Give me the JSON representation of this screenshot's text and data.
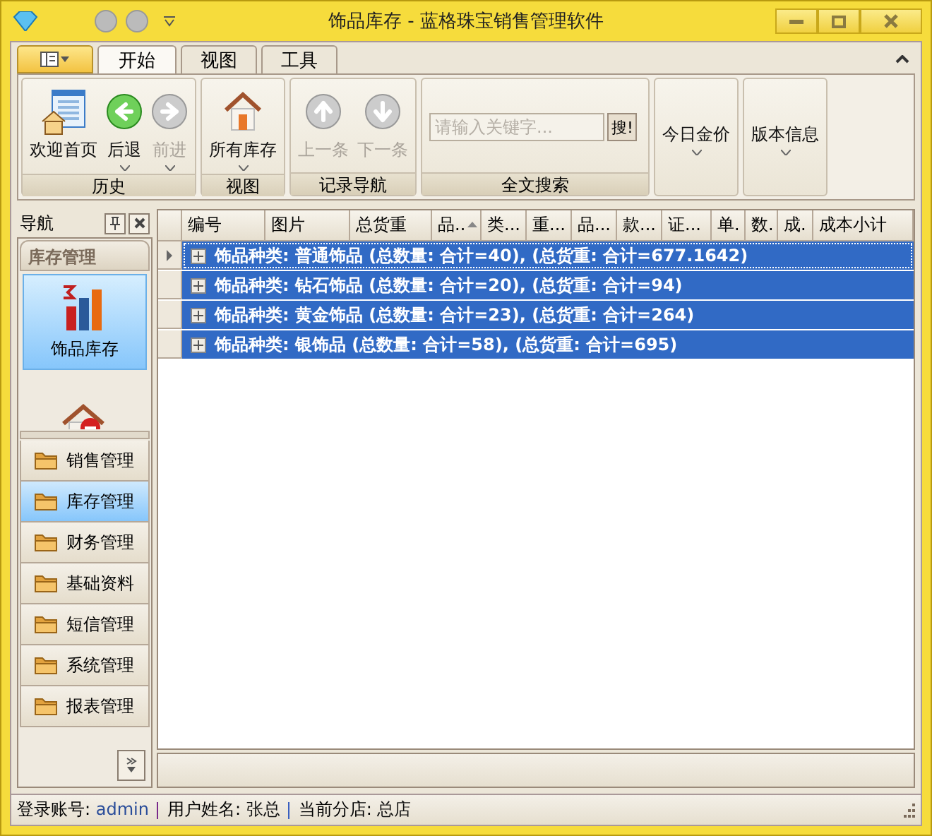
{
  "window": {
    "title": "饰品库存 - 蓝格珠宝销售管理软件"
  },
  "ribbon": {
    "tabs": [
      {
        "label": "开始",
        "selected": true
      },
      {
        "label": "视图",
        "selected": false
      },
      {
        "label": "工具",
        "selected": false
      }
    ],
    "groups": [
      {
        "label": "历史",
        "buttons": [
          {
            "label": "欢迎首页",
            "disabled": false,
            "dropdown": false
          },
          {
            "label": "后退",
            "disabled": false,
            "dropdown": true
          },
          {
            "label": "前进",
            "disabled": true,
            "dropdown": true
          }
        ]
      },
      {
        "label": "视图",
        "buttons": [
          {
            "label": "所有库存",
            "disabled": false,
            "dropdown": true
          }
        ]
      },
      {
        "label": "记录导航",
        "buttons": [
          {
            "label": "上一条",
            "disabled": true,
            "dropdown": false
          },
          {
            "label": "下一条",
            "disabled": true,
            "dropdown": false
          }
        ]
      },
      {
        "label": "全文搜索",
        "search": {
          "placeholder": "请输入关键字...",
          "button": "搜!"
        }
      },
      {
        "buttons": [
          {
            "label": "今日金价",
            "disabled": false,
            "dropdown": true
          }
        ]
      },
      {
        "buttons": [
          {
            "label": "版本信息",
            "disabled": false,
            "dropdown": true
          }
        ]
      }
    ]
  },
  "nav": {
    "title": "导航",
    "section": "库存管理",
    "large_items": [
      {
        "label": "饰品库存",
        "selected": true
      },
      {
        "selected": false
      }
    ],
    "groups": [
      {
        "label": "销售管理",
        "selected": false
      },
      {
        "label": "库存管理",
        "selected": true
      },
      {
        "label": "财务管理",
        "selected": false
      },
      {
        "label": "基础资料",
        "selected": false
      },
      {
        "label": "短信管理",
        "selected": false
      },
      {
        "label": "系统管理",
        "selected": false
      },
      {
        "label": "报表管理",
        "selected": false
      }
    ]
  },
  "table": {
    "columns": [
      {
        "label": "编号",
        "sorted": false
      },
      {
        "label": "图片",
        "sorted": false
      },
      {
        "label": "总货重",
        "sorted": false
      },
      {
        "label": "品..",
        "sorted": true
      },
      {
        "label": "类...",
        "sorted": false
      },
      {
        "label": "重...",
        "sorted": false
      },
      {
        "label": "品...",
        "sorted": false
      },
      {
        "label": "款...",
        "sorted": false
      },
      {
        "label": "证...",
        "sorted": false
      },
      {
        "label": "单.",
        "sorted": false
      },
      {
        "label": "数.",
        "sorted": false
      },
      {
        "label": "成.",
        "sorted": false
      },
      {
        "label": "成本小计",
        "sorted": false
      }
    ],
    "rows": [
      {
        "text": "饰品种类: 普通饰品 (总数量: 合计=40), (总货重: 合计=677.1642)",
        "current": true,
        "selected": true
      },
      {
        "text": "饰品种类: 钻石饰品 (总数量: 合计=20), (总货重: 合计=94)",
        "current": false,
        "selected": true
      },
      {
        "text": "饰品种类: 黄金饰品 (总数量: 合计=23), (总货重: 合计=264)",
        "current": false,
        "selected": true
      },
      {
        "text": "饰品种类: 银饰品 (总数量: 合计=58), (总货重: 合计=695)",
        "current": false,
        "selected": true
      }
    ]
  },
  "status_bar": [
    {
      "label": "登录账号:",
      "value": "admin"
    },
    {
      "label": "用户姓名:",
      "value": "张总"
    },
    {
      "label": "当前分店:",
      "value": "总店"
    }
  ]
}
